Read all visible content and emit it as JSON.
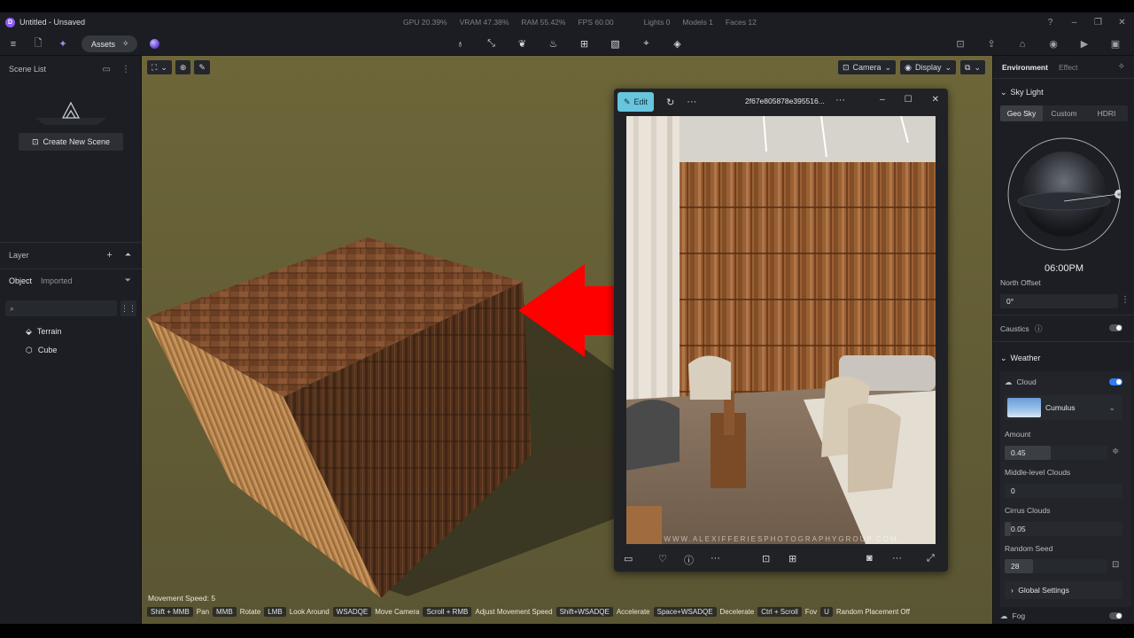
{
  "app": {
    "title": "Untitled - Unsaved",
    "logo_letter": "D"
  },
  "stats": {
    "gpu": "GPU 20.39%",
    "vram": "VRAM 47.38%",
    "ram": "RAM 55.42%",
    "fps": "FPS 60.00",
    "lights": "Lights 0",
    "models": "Models 1",
    "faces": "Faces 12"
  },
  "toolbar": {
    "assets_label": "Assets"
  },
  "left_panel": {
    "scene_list_title": "Scene List",
    "create_scene_label": "Create New Scene",
    "layer_title": "Layer",
    "tabs": {
      "object": "Object",
      "imported": "Imported"
    },
    "search_placeholder": "",
    "tree": [
      {
        "label": "Terrain"
      },
      {
        "label": "Cube"
      }
    ]
  },
  "viewport": {
    "camera_label": "Camera",
    "display_label": "Display",
    "movement_speed": "Movement Speed: 5",
    "hotkeys": [
      {
        "key": "Shift + MMB",
        "desc": "Pan"
      },
      {
        "key": "MMB",
        "desc": "Rotate"
      },
      {
        "key": "LMB",
        "desc": "Look Around"
      },
      {
        "key": "WSADQE",
        "desc": "Move Camera"
      },
      {
        "key": "Scroll + RMB",
        "desc": "Adjust Movement Speed"
      },
      {
        "key": "Shift+WSADQE",
        "desc": "Accelerate"
      },
      {
        "key": "Space+WSADQE",
        "desc": "Decelerate"
      },
      {
        "key": "Ctrl + Scroll",
        "desc": "Fov"
      },
      {
        "key": "U",
        "desc": "Random Placement Off"
      }
    ]
  },
  "viewer": {
    "edit_label": "Edit",
    "filename": "2f67e805878e395516...",
    "watermark": "WWW.ALEXIFFERIESPHOTOGRAPHYGROUP.COM"
  },
  "right_panel": {
    "tabs": {
      "environment": "Environment",
      "effect": "Effect"
    },
    "sky_light_title": "Sky Light",
    "sky_modes": [
      "Geo Sky",
      "Custom",
      "HDRI"
    ],
    "time": "06:00PM",
    "north_offset_label": "North Offset",
    "north_offset_value": "0°",
    "caustics_label": "Caustics",
    "caustics_on": false,
    "weather_title": "Weather",
    "cloud_label": "Cloud",
    "cloud_on": true,
    "cloud_type": "Cumulus",
    "amount_label": "Amount",
    "amount_value": "0.45",
    "middle_clouds_label": "Middle-level Clouds",
    "middle_clouds_value": "0",
    "cirrus_label": "Cirrus Clouds",
    "cirrus_value": "0.05",
    "seed_label": "Random Seed",
    "seed_value": "28",
    "global_settings_label": "Global Settings",
    "fog_label": "Fog",
    "fog_on": false
  },
  "colors": {
    "accent": "#2f7bf5",
    "edit_button": "#67c5dd",
    "arrow": "#ff0000"
  }
}
